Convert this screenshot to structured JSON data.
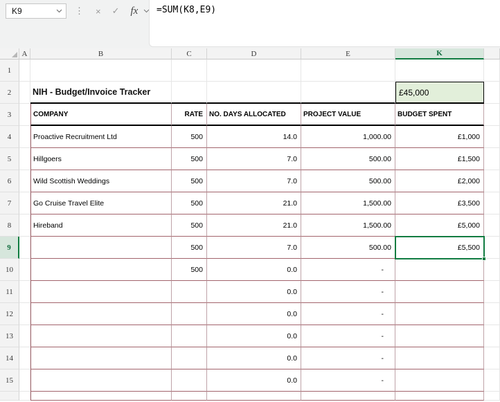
{
  "formula_bar": {
    "name_box_value": "K9",
    "formula": "=SUM(K8,E9)",
    "fx_label": "fx"
  },
  "icons": {
    "dots": "⋮",
    "cancel": "×",
    "confirm": "✓"
  },
  "column_headers": [
    "A",
    "B",
    "C",
    "D",
    "E",
    "K"
  ],
  "row_numbers": [
    "1",
    "2",
    "3",
    "4",
    "5",
    "6",
    "7",
    "8",
    "9",
    "10",
    "11",
    "12",
    "13",
    "14",
    "15"
  ],
  "selection": {
    "cell_ref": "K9",
    "row": 9,
    "column": "K"
  },
  "sheet": {
    "title": "NIH - Budget/Invoice Tracker",
    "budget_total": "£45,000",
    "headers": {
      "company": "COMPANY",
      "rate": "RATE",
      "days": "NO. DAYS ALLOCATED",
      "value": "PROJECT VALUE",
      "spent": "BUDGET SPENT"
    },
    "rows": [
      {
        "company": "Proactive Recruitment Ltd",
        "rate": "500",
        "days": "14.0",
        "value": "1,000.00",
        "spent": "£1,000"
      },
      {
        "company": "Hillgoers",
        "rate": "500",
        "days": "7.0",
        "value": "500.00",
        "spent": "£1,500"
      },
      {
        "company": "Wild Scottish Weddings",
        "rate": "500",
        "days": "7.0",
        "value": "500.00",
        "spent": "£2,000"
      },
      {
        "company": "Go Cruise Travel Elite",
        "rate": "500",
        "days": "21.0",
        "value": "1,500.00",
        "spent": "£3,500"
      },
      {
        "company": "Hireband",
        "rate": "500",
        "days": "21.0",
        "value": "1,500.00",
        "spent": "£5,000"
      },
      {
        "company": "",
        "rate": "500",
        "days": "7.0",
        "value": "500.00",
        "spent": "£5,500"
      },
      {
        "company": "",
        "rate": "500",
        "days": "0.0",
        "value": "-",
        "spent": ""
      },
      {
        "company": "",
        "rate": "",
        "days": "0.0",
        "value": "-",
        "spent": ""
      },
      {
        "company": "",
        "rate": "",
        "days": "0.0",
        "value": "-",
        "spent": ""
      },
      {
        "company": "",
        "rate": "",
        "days": "0.0",
        "value": "-",
        "spent": ""
      },
      {
        "company": "",
        "rate": "",
        "days": "0.0",
        "value": "-",
        "spent": ""
      },
      {
        "company": "",
        "rate": "",
        "days": "0.0",
        "value": "-",
        "spent": ""
      }
    ]
  },
  "colors": {
    "accent_green": "#107c41",
    "selected_fill": "#e2efda",
    "table_border": "#a2646c"
  }
}
